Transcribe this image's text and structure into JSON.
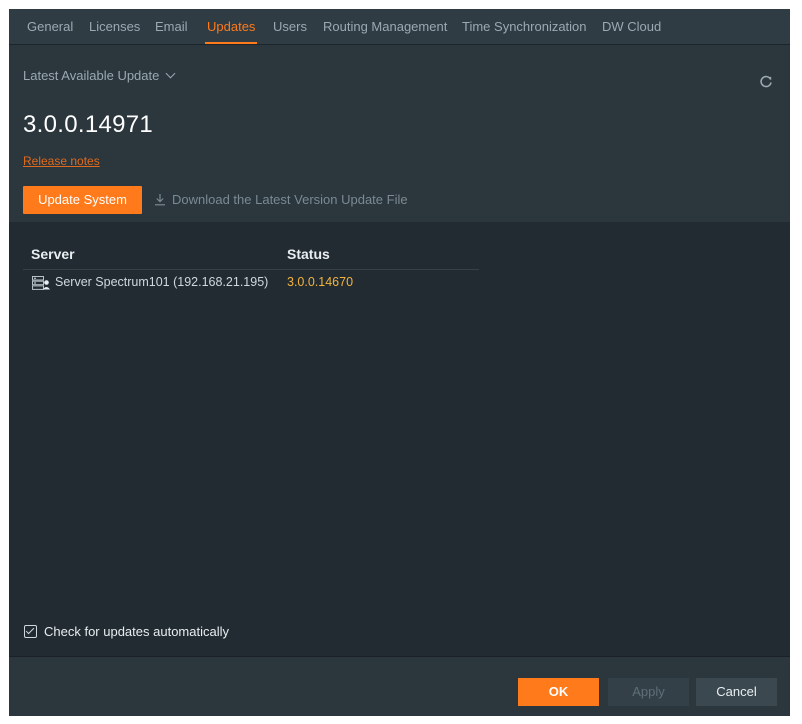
{
  "tabs": [
    "General",
    "Licenses",
    "Email",
    "Updates",
    "Users",
    "Routing Management",
    "Time Synchronization",
    "DW Cloud"
  ],
  "active_tab": "Updates",
  "update_panel": {
    "dropdown_label": "Latest Available Update",
    "version": "3.0.0.14971",
    "release_notes": "Release notes",
    "update_button": "Update System",
    "download_link": "Download the Latest Version Update File"
  },
  "table": {
    "headers": {
      "server": "Server",
      "status": "Status"
    },
    "rows": [
      {
        "server": "Server Spectrum101 (192.168.21.195)",
        "status": "3.0.0.14670"
      }
    ]
  },
  "auto_check": {
    "label": "Check for updates automatically",
    "checked": true
  },
  "footer": {
    "ok": "OK",
    "apply": "Apply",
    "cancel": "Cancel"
  },
  "colors": {
    "accent": "#ff7a1a",
    "status": "#f2b33d",
    "background": "#212b31",
    "panel": "#2b363d"
  },
  "icons": {
    "dropdown": "chevron-down-icon",
    "refresh": "refresh-icon",
    "download": "download-icon",
    "server": "server-icon",
    "checkbox": "checkbox-checked-icon"
  }
}
